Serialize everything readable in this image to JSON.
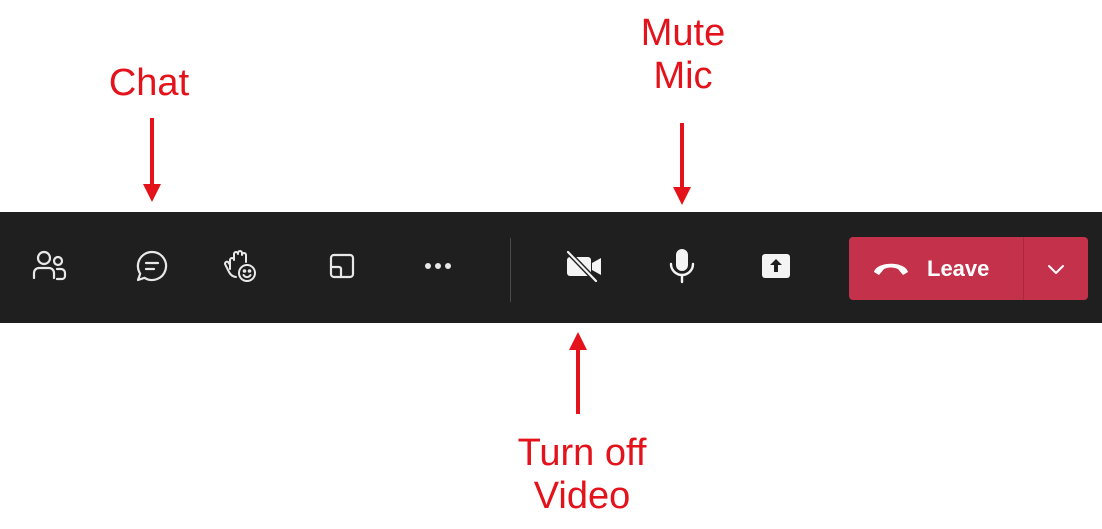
{
  "annotations": {
    "chat": "Chat",
    "mute_mic_line1": "Mute",
    "mute_mic_line2": "Mic",
    "video_line1": "Turn off",
    "video_line2": "Video",
    "color": "#e3121b"
  },
  "toolbar": {
    "background": "#1f1f1f",
    "buttons": [
      {
        "id": "people",
        "icon": "people-icon"
      },
      {
        "id": "chat",
        "icon": "chat-icon"
      },
      {
        "id": "react",
        "icon": "raise-hand-react-icon"
      },
      {
        "id": "rooms",
        "icon": "rooms-icon"
      },
      {
        "id": "more",
        "icon": "more-icon"
      },
      {
        "id": "camera",
        "icon": "camera-off-icon"
      },
      {
        "id": "mic",
        "icon": "mic-icon"
      },
      {
        "id": "share",
        "icon": "share-icon"
      }
    ],
    "leave": {
      "label": "Leave",
      "icon": "hang-up-icon",
      "dropdown_icon": "chevron-down-icon",
      "color": "#c4314b"
    }
  }
}
